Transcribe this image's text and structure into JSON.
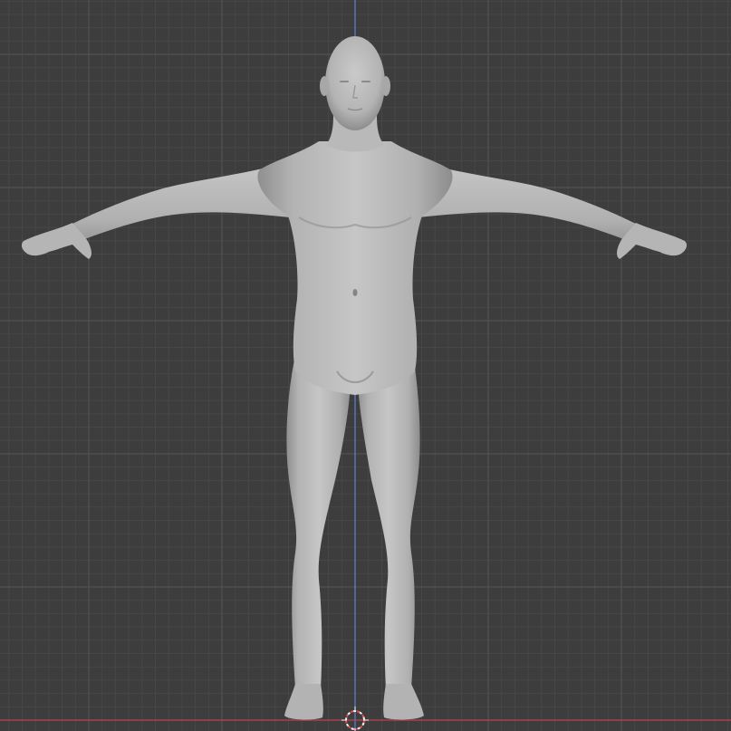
{
  "viewport": {
    "view": "front-orthographic",
    "grid": true,
    "colors": {
      "background": "#3d3d3d",
      "grid_minor": "#474747",
      "grid_major": "#525252",
      "axis_z": "#5a7ac8",
      "axis_x": "#b8414f",
      "mesh_light": "#c2c2c2",
      "mesh_mid": "#a9a9a9",
      "mesh_shadow": "#7c7c7c",
      "cursor_red": "#e05050",
      "cursor_white": "#f2f2f2"
    }
  },
  "scene": {
    "object": "human-base-mesh",
    "pose": "T-pose",
    "shading": "solid"
  },
  "cursor": {
    "icon": "3d-cursor-icon"
  }
}
